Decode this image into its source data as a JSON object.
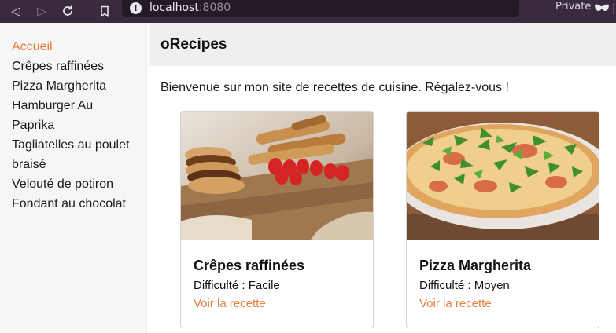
{
  "browser": {
    "url_host": "localhost",
    "url_port": ":8080",
    "private_label": "Private"
  },
  "sidebar": {
    "items": [
      {
        "label": "Accueil",
        "active": true
      },
      {
        "label": "Crêpes raffinées"
      },
      {
        "label": "Pizza Margherita"
      },
      {
        "label": "Hamburger Au"
      },
      {
        "label": "Paprika"
      },
      {
        "label": "Tagliatelles au poulet"
      },
      {
        "label": "braisé"
      },
      {
        "label": "Velouté de potiron"
      },
      {
        "label": "Fondant au chocolat"
      }
    ]
  },
  "header": {
    "brand": "oRecipes"
  },
  "main": {
    "welcome": "Bienvenue sur mon site de recettes de cuisine. Régalez-vous !",
    "cards": [
      {
        "title": "Crêpes raffinées",
        "difficulty": "Difficulté : Facile",
        "link": "Voir la recette",
        "image_icon": "crepes-photo"
      },
      {
        "title": "Pizza Margherita",
        "difficulty": "Difficulté : Moyen",
        "link": "Voir la recette",
        "image_icon": "pizza-photo"
      }
    ]
  },
  "colors": {
    "accent": "#e47d3c",
    "chrome": "#3a2a3e",
    "urlbar": "#241a27",
    "sidebar": "#f6f6f6"
  }
}
